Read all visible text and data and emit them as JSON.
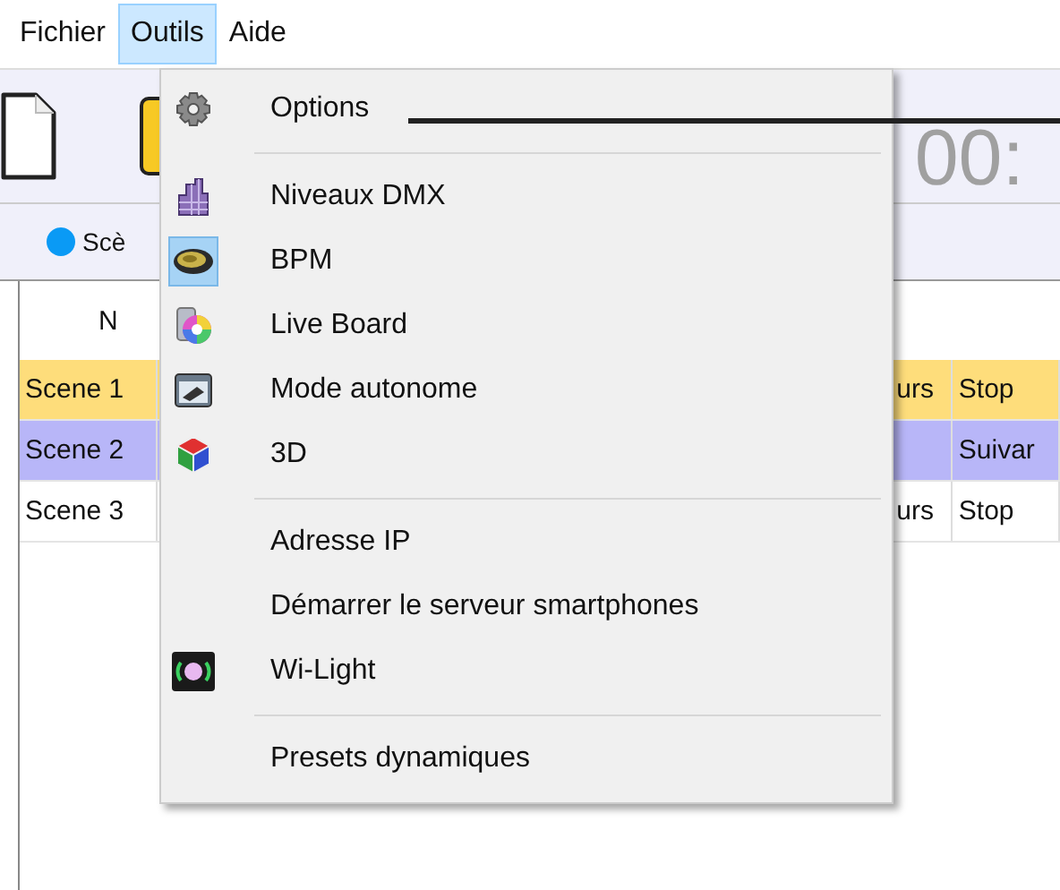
{
  "menu_bar": [
    {
      "label": "Fichier",
      "selected": false
    },
    {
      "label": "Outils",
      "selected": true
    },
    {
      "label": "Aide",
      "selected": false
    }
  ],
  "toolbar": {
    "clock": "00:"
  },
  "tabs": [
    {
      "label": "Scè",
      "selected": true
    }
  ],
  "table": {
    "header": "N",
    "rows": [
      {
        "column_1": "Scene 1",
        "column_3": "urs",
        "column_4": "Stop",
        "color": "#fedd7b"
      },
      {
        "column_1": "Scene 2",
        "column_4": "Suivar",
        "color": "#b8b6f8"
      },
      {
        "column_1": "Scene 3",
        "column_3": "urs",
        "column_4": "Stop",
        "color": "#ffffff"
      }
    ]
  },
  "dropdown": {
    "items": [
      {
        "kind": "item",
        "label": "Options",
        "checked": false
      },
      {
        "kind": "separator"
      },
      {
        "kind": "item",
        "label": "Niveaux DMX",
        "checked": false
      },
      {
        "kind": "item",
        "label": "BPM",
        "checked": true
      },
      {
        "kind": "item",
        "label": "Live Board",
        "checked": false
      },
      {
        "kind": "item",
        "label": "Mode autonome",
        "checked": false
      },
      {
        "kind": "item",
        "label": "3D",
        "checked": false
      },
      {
        "kind": "separator"
      },
      {
        "kind": "item",
        "label": "Adresse IP",
        "checked": false
      },
      {
        "kind": "item",
        "label": "Démarrer le serveur smartphones",
        "checked": false
      },
      {
        "kind": "item",
        "label": "Wi-Light",
        "checked": false
      },
      {
        "kind": "separator"
      },
      {
        "kind": "item",
        "label": "Presets dynamiques",
        "checked": false
      }
    ]
  }
}
